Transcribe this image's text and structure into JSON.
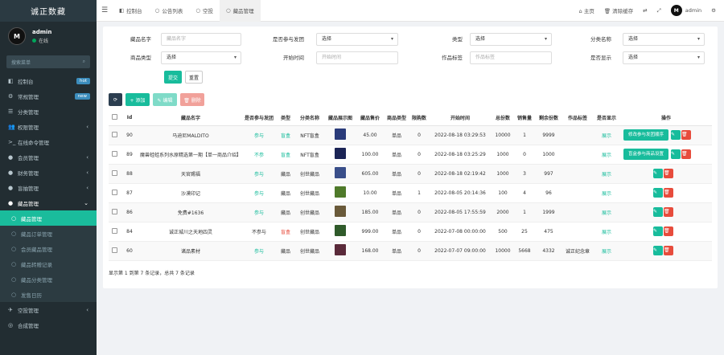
{
  "brand": "诚正数藏",
  "user": {
    "name": "admin",
    "status": "在线",
    "avatar": "M"
  },
  "sidebar": {
    "search_placeholder": "搜索菜单",
    "items": [
      {
        "label": "控制台",
        "icon": "dashboard-icon",
        "badge": "hot",
        "badge_color": "#3c8dbc"
      },
      {
        "label": "常规管理",
        "icon": "cogs-icon",
        "badge": "new",
        "badge_color": "#3c8dbc"
      },
      {
        "label": "分类管理",
        "icon": "list-icon"
      },
      {
        "label": "权限管理",
        "icon": "group-icon",
        "arrow": "‹"
      },
      {
        "label": "在线命令管理",
        "icon": "terminal-icon"
      },
      {
        "label": "会员管理",
        "icon": "user-icon",
        "arrow": "‹"
      },
      {
        "label": "财务管理",
        "icon": "money-icon",
        "arrow": "‹"
      },
      {
        "label": "盲抽管理",
        "icon": "box-icon",
        "arrow": "‹"
      },
      {
        "label": "藏品管理",
        "icon": "gem-icon",
        "arrow": "⌄",
        "open": true
      },
      {
        "label": "藏品管理",
        "icon": "circle-icon",
        "sub": true,
        "active": true
      },
      {
        "label": "藏品订单管理",
        "icon": "circle-icon",
        "sub": true
      },
      {
        "label": "会员藏品管理",
        "icon": "circle-icon",
        "sub": true
      },
      {
        "label": "藏品转赠记录",
        "icon": "circle-icon",
        "sub": true
      },
      {
        "label": "藏品分类管理",
        "icon": "circle-icon",
        "sub": true
      },
      {
        "label": "发售日历",
        "icon": "circle-icon",
        "sub": true
      },
      {
        "label": "空投管理",
        "icon": "plane-icon",
        "arrow": "‹"
      },
      {
        "label": "合成管理",
        "icon": "merge-icon"
      }
    ]
  },
  "topbar": {
    "tabs": [
      {
        "label": "控制台",
        "icon": "dashboard-icon"
      },
      {
        "label": "公告列表",
        "icon": "circle-icon"
      },
      {
        "label": "空投",
        "icon": "circle-icon"
      },
      {
        "label": "藏品管理",
        "icon": "circle-icon",
        "active": true
      }
    ],
    "home": "主页",
    "clear_cache": "清除缓存",
    "user": "admin"
  },
  "filters": {
    "name_label": "藏品名字",
    "name_placeholder": "藏品名字",
    "join_label": "是否参与发团",
    "join_value": "选择",
    "type_label": "类型",
    "type_value": "选择",
    "category_label": "分类名称",
    "category_value": "选择",
    "goods_type_label": "商品类型",
    "goods_type_value": "选择",
    "time_label": "开始时间",
    "time_placeholder": "开始时间",
    "tag_label": "作品标签",
    "tag_placeholder": "作品标签",
    "show_label": "是否显示",
    "show_value": "选择",
    "submit": "提交",
    "reset": "重置"
  },
  "toolbar": {
    "refresh": "⟳",
    "add": "+ 添加",
    "edit": "✎ 编辑",
    "delete": "🗑 删除"
  },
  "table": {
    "headers": [
      "",
      "Id",
      "藏品名字",
      "是否参与发团",
      "类型",
      "分类名称",
      "藏品展示图",
      "藏品售价",
      "商品类型",
      "限购数",
      "开始时间",
      "总份数",
      "销售量",
      "剩余份数",
      "作品标签",
      "是否显示",
      "操作"
    ],
    "rows": [
      {
        "id": "90",
        "name": "马迪尼MALDITO",
        "join": "参与",
        "type": "盲盒",
        "category": "NFT盲盒",
        "price": "45.00",
        "goods": "单品",
        "limit": "0",
        "start": "2022-08-18 03:29:53",
        "total": "10000",
        "sold": "1",
        "left": "9999",
        "tag": "",
        "show": "展示",
        "thumb": "#2a3b7a",
        "ops": [
          "修改参与发团顺序"
        ]
      },
      {
        "id": "89",
        "name": "魔兽蛙蛙系列水原精选第一期【单一商品介绍】",
        "join": "不参",
        "type": "盲盒",
        "category": "NFT盲盒",
        "price": "100.00",
        "goods": "单品",
        "limit": "0",
        "start": "2022-08-18 03:25:29",
        "total": "1000",
        "sold": "0",
        "left": "1000",
        "tag": "",
        "show": "展示",
        "thumb": "#1b2455",
        "ops": [
          "盲盒参与商品设置"
        ]
      },
      {
        "id": "88",
        "name": "天官赐福",
        "join": "参与",
        "type": "藏品",
        "category": "创世藏品",
        "price": "605.00",
        "goods": "单品",
        "limit": "0",
        "start": "2022-08-18 02:19:42",
        "total": "1000",
        "sold": "3",
        "left": "997",
        "tag": "",
        "show": "展示",
        "thumb": "#3a4f8a",
        "ops": []
      },
      {
        "id": "87",
        "name": "沙漠印记",
        "join": "参与",
        "type": "藏品",
        "category": "创世藏品",
        "price": "10.00",
        "goods": "单品",
        "limit": "1",
        "start": "2022-08-05 20:14:36",
        "total": "100",
        "sold": "4",
        "left": "96",
        "tag": "",
        "show": "展示",
        "thumb": "#4f7a2a",
        "ops": []
      },
      {
        "id": "86",
        "name": "免费#1636",
        "join": "参与",
        "type": "藏品",
        "category": "创世藏品",
        "price": "185.00",
        "goods": "单品",
        "limit": "0",
        "start": "2022-08-05 17:55:59",
        "total": "2000",
        "sold": "1",
        "left": "1999",
        "tag": "",
        "show": "展示",
        "thumb": "#6a5a3a",
        "ops": []
      },
      {
        "id": "84",
        "name": "诚正城川之天地四灵",
        "join": "不参与",
        "type": "盲盒",
        "category": "创世藏品",
        "price": "999.00",
        "goods": "单品",
        "limit": "0",
        "start": "2022-07-08 00:00:00",
        "total": "500",
        "sold": "25",
        "left": "475",
        "tag": "",
        "show": "展示",
        "thumb": "#2f5a2a",
        "ops": []
      },
      {
        "id": "60",
        "name": "诸品素材",
        "join": "参与",
        "type": "藏品",
        "category": "创世藏品",
        "price": "168.00",
        "goods": "单品",
        "limit": "0",
        "start": "2022-07-07 09:00:00",
        "total": "10000",
        "sold": "5668",
        "left": "4332",
        "tag": "诚正纪念章",
        "show": "展示",
        "thumb": "#5a2a3a",
        "ops": []
      }
    ]
  },
  "footer": "显示第 1 到第 7 条记录，总共 7 条记录"
}
